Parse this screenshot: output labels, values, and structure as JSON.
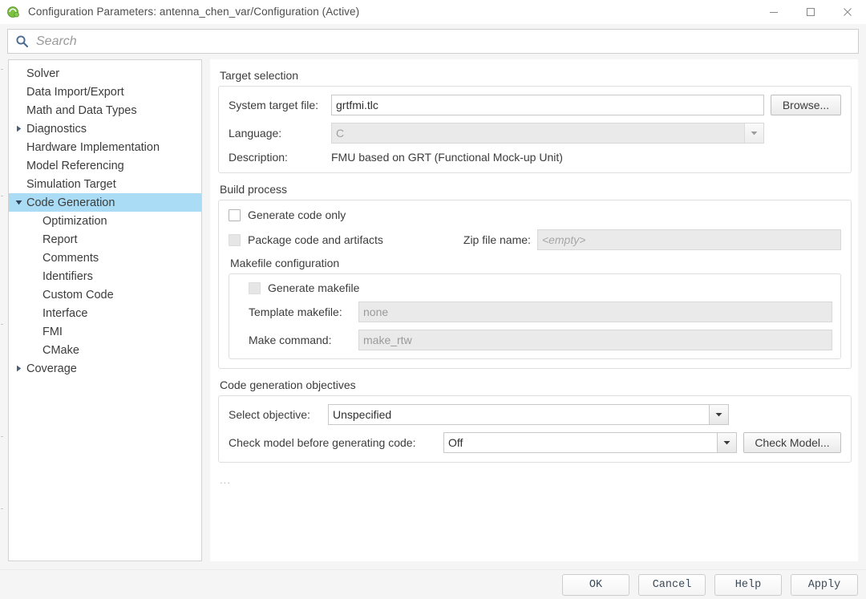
{
  "window": {
    "title": "Configuration Parameters: antenna_chen_var/Configuration (Active)",
    "app_icon": "simulink-icon",
    "controls": {
      "minimize": "minimize-icon",
      "maximize": "maximize-icon",
      "close": "close-icon"
    }
  },
  "search": {
    "icon": "search-icon",
    "placeholder": "Search",
    "value": ""
  },
  "sidebar": {
    "items": [
      {
        "label": "Solver",
        "level": 1,
        "arrow": "none",
        "selected": false
      },
      {
        "label": "Data Import/Export",
        "level": 1,
        "arrow": "none",
        "selected": false
      },
      {
        "label": "Math and Data Types",
        "level": 1,
        "arrow": "none",
        "selected": false
      },
      {
        "label": "Diagnostics",
        "level": 1,
        "arrow": "collapsed",
        "selected": false
      },
      {
        "label": "Hardware Implementation",
        "level": 1,
        "arrow": "none",
        "selected": false
      },
      {
        "label": "Model Referencing",
        "level": 1,
        "arrow": "none",
        "selected": false
      },
      {
        "label": "Simulation Target",
        "level": 1,
        "arrow": "none",
        "selected": false
      },
      {
        "label": "Code Generation",
        "level": 1,
        "arrow": "expanded",
        "selected": true
      },
      {
        "label": "Optimization",
        "level": 2,
        "arrow": "none",
        "selected": false
      },
      {
        "label": "Report",
        "level": 2,
        "arrow": "none",
        "selected": false
      },
      {
        "label": "Comments",
        "level": 2,
        "arrow": "none",
        "selected": false
      },
      {
        "label": "Identifiers",
        "level": 2,
        "arrow": "none",
        "selected": false
      },
      {
        "label": "Custom Code",
        "level": 2,
        "arrow": "none",
        "selected": false
      },
      {
        "label": "Interface",
        "level": 2,
        "arrow": "none",
        "selected": false
      },
      {
        "label": "FMI",
        "level": 2,
        "arrow": "none",
        "selected": false
      },
      {
        "label": "CMake",
        "level": 2,
        "arrow": "none",
        "selected": false
      },
      {
        "label": "Coverage",
        "level": 1,
        "arrow": "collapsed",
        "selected": false
      }
    ]
  },
  "main": {
    "target_selection": {
      "title": "Target selection",
      "system_target_file": {
        "label": "System target file:",
        "value": "grtfmi.tlc"
      },
      "browse_button": "Browse...",
      "language": {
        "label": "Language:",
        "value": "C",
        "disabled": true
      },
      "description": {
        "label": "Description:",
        "value": "FMU based on GRT (Functional Mock-up Unit)"
      }
    },
    "build_process": {
      "title": "Build process",
      "generate_code_only": {
        "label": "Generate code only",
        "checked": false,
        "disabled": false
      },
      "package_code_and_artifacts": {
        "label": "Package code and artifacts",
        "checked": false,
        "disabled": true
      },
      "zip_file_name": {
        "label": "Zip file name:",
        "value": "<empty>",
        "disabled": true
      },
      "makefile_configuration": {
        "title": "Makefile configuration",
        "generate_makefile": {
          "label": "Generate makefile",
          "checked": false,
          "disabled": true
        },
        "template_makefile": {
          "label": "Template makefile:",
          "value": "none",
          "disabled": true
        },
        "make_command": {
          "label": "Make command:",
          "value": "make_rtw",
          "disabled": true
        }
      }
    },
    "code_generation_objectives": {
      "title": "Code generation objectives",
      "select_objective": {
        "label": "Select objective:",
        "value": "Unspecified"
      },
      "check_model": {
        "label": "Check model before generating code:",
        "value": "Off"
      },
      "check_model_button": "Check Model..."
    },
    "overflow_indicator": "..."
  },
  "footer": {
    "buttons": [
      "OK",
      "Cancel",
      "Help",
      "Apply"
    ]
  }
}
